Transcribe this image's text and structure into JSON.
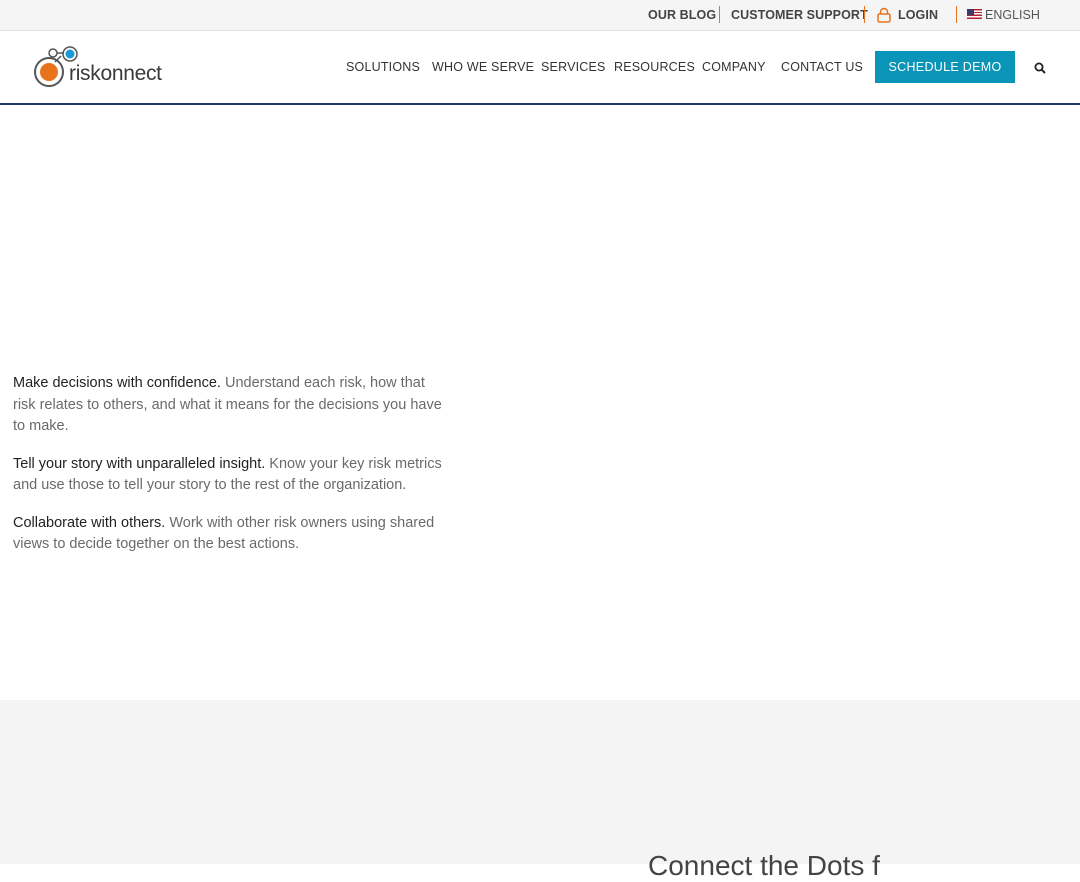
{
  "topbar": {
    "blog": "OUR BLOG",
    "support": "CUSTOMER SUPPORT",
    "login": "LOGIN",
    "language": "ENGLISH"
  },
  "logo": {
    "text": "riskonnect",
    "colors": {
      "orange": "#e8731d",
      "blue": "#1b9ad6",
      "gray": "#555555"
    }
  },
  "nav": {
    "items": [
      "SOLUTIONS",
      "WHO WE SERVE",
      "SERVICES",
      "RESOURCES",
      "COMPANY",
      "CONTACT US"
    ],
    "cta": "SCHEDULE DEMO",
    "cta_color": "#0a94b8"
  },
  "features": [
    {
      "title": "Make decisions with confidence.",
      "text": "Understand each risk, how that risk relates to others, and what it means for the decisions you have to make."
    },
    {
      "title": "Tell your story with unparalleled insight.",
      "text": "Know your key risk metrics and use those to tell your story to the rest of the organization."
    },
    {
      "title": "Collaborate with others.",
      "text": "Work with other risk owners using shared views to decide together on the best actions."
    }
  ],
  "next_section": {
    "heading_partial": "Connect the Dots f"
  },
  "icons": [
    "lock-icon",
    "chevron-down-icon",
    "us-flag-icon",
    "search-icon"
  ]
}
